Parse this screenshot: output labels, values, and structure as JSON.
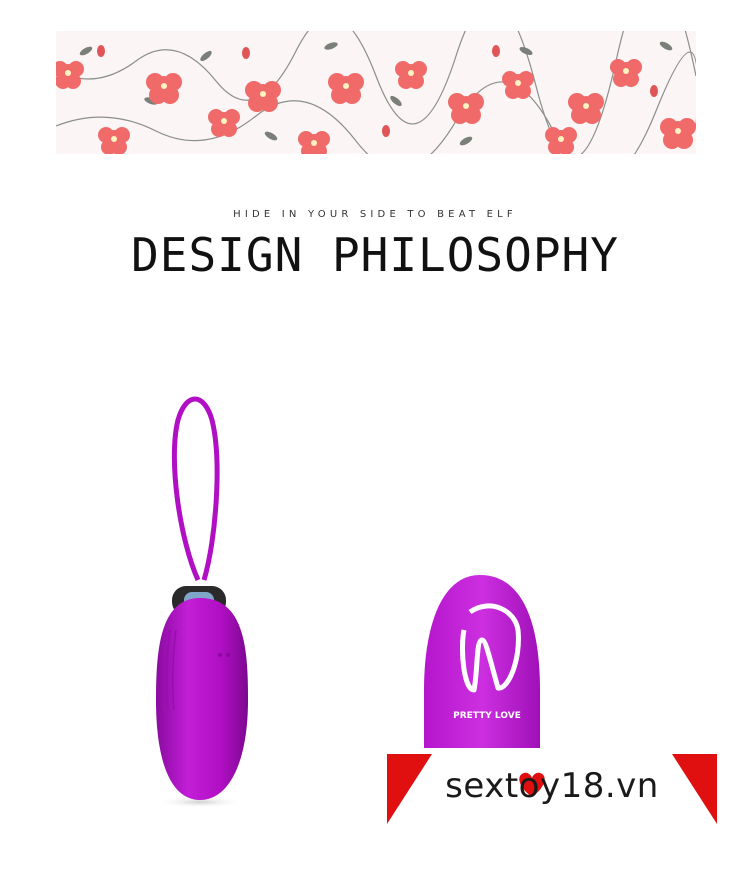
{
  "banner": {
    "subtitle": "HIDE IN YOUR SIDE TO BEAT ELF",
    "title": "DESIGN PHILOSOPHY"
  },
  "product": {
    "brand_on_remote": "PRETTY LOVE",
    "color": "#b10fc4"
  },
  "watermark": {
    "text": "sextoy18.vn",
    "accent_color": "#e01010"
  },
  "colors": {
    "flower": "#f06a6a",
    "leaf": "#7a7f7a",
    "background": "#ffffff"
  }
}
